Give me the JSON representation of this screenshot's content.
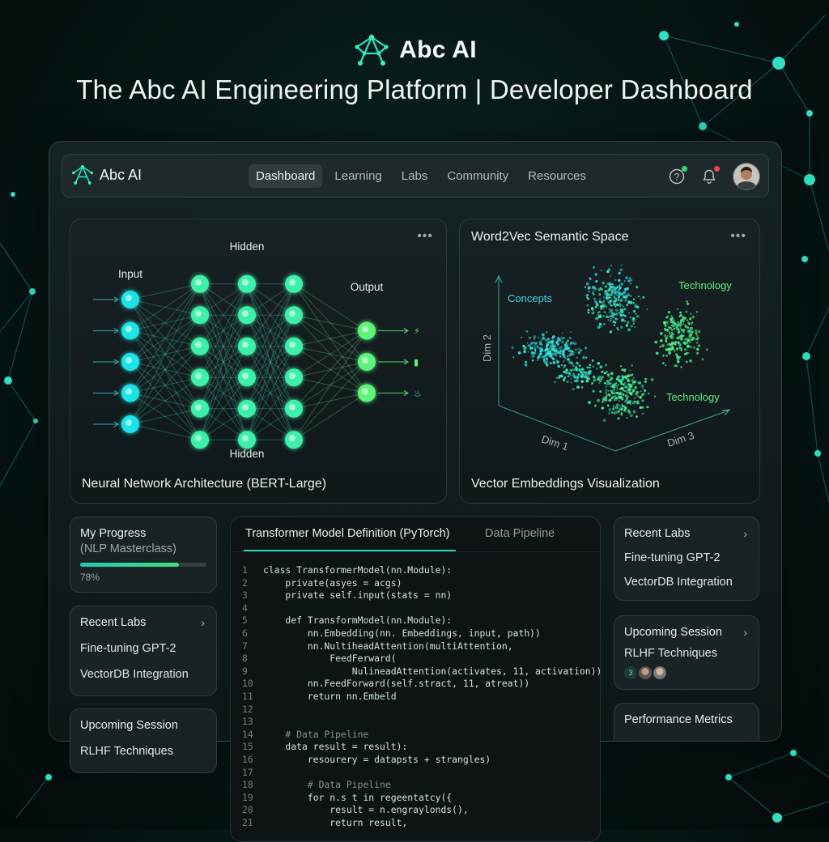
{
  "brand": {
    "name": "Abc AI"
  },
  "headline": "The Abc AI Engineering Platform | Developer Dashboard",
  "nav": {
    "brand": "Abc AI",
    "links": [
      "Dashboard",
      "Learning",
      "Labs",
      "Community",
      "Resources"
    ],
    "active": "Dashboard",
    "icons": [
      "help-icon",
      "bell-icon",
      "avatar"
    ],
    "colors": {
      "help_dot": "#2fdc6e",
      "bell_dot": "#f0454a"
    }
  },
  "nn_panel": {
    "labels": {
      "input": "Input",
      "hidden_top": "Hidden",
      "hidden_bottom": "Hidden",
      "output": "Output"
    },
    "caption": "Neural Network Architecture (BERT-Large)",
    "layers": [
      5,
      6,
      6,
      6,
      3
    ],
    "colors": {
      "input": "#1ee3e6",
      "hidden": "#3ef0a8",
      "output": "#5cf47a"
    }
  },
  "embedding_panel": {
    "title": "Word2Vec Semantic Space",
    "clusters": [
      "Concepts",
      "Technology",
      "Technology"
    ],
    "axes": {
      "y": "Dim 2",
      "x": "Dim 1",
      "z": "Dim 3"
    },
    "caption": "Vector Embeddings Visualization"
  },
  "progress_card": {
    "title": "My Progress",
    "subtitle": "(NLP Masterclass)",
    "percent_label": "78%",
    "fraction": 0.78
  },
  "recent_labs_left": {
    "title": "Recent Labs",
    "items": [
      "Fine-tuning GPT-2",
      "VectorDB Integration"
    ]
  },
  "upcoming_left": {
    "title": "Upcoming Session",
    "item": "RLHF Techniques"
  },
  "code_panel": {
    "tabs": [
      "Transformer Model Definition (PyTorch)",
      "Data Pipeline"
    ],
    "active_tab": "Transformer Model Definition (PyTorch)",
    "lines": [
      "class TransformerModel(nn.Module):",
      "    private(asyes = acgs)",
      "    private self.input(stats = nn)",
      "",
      "    def TransformModel(nn.Module):",
      "        nn.Embedding(nn. Embeddings, input, path))",
      "        nn.NultiheadAttention(multiAttention,",
      "            FeedFerward(",
      "                NulineadAttention(activates, 11, activation))",
      "        nn.FeedForward(self.stract, 11, atreat))",
      "        return nn.Embeld",
      "",
      "",
      "    # Data Pipeline",
      "    data result = result):",
      "        resourery = datapsts + strangles)",
      "",
      "        # Data Pipeline",
      "        for n.s t in regeentatcy({",
      "            result = n.engraylonds(),",
      "            return result,"
    ]
  },
  "recent_labs_right": {
    "title": "Recent Labs",
    "items": [
      "Fine-tuning GPT-2",
      "VectorDB Integration"
    ]
  },
  "upcoming_right": {
    "title": "Upcoming Session",
    "item": "RLHF Techniques",
    "attendee_badge": "3"
  },
  "performance": {
    "title": "Performance Metrics"
  }
}
